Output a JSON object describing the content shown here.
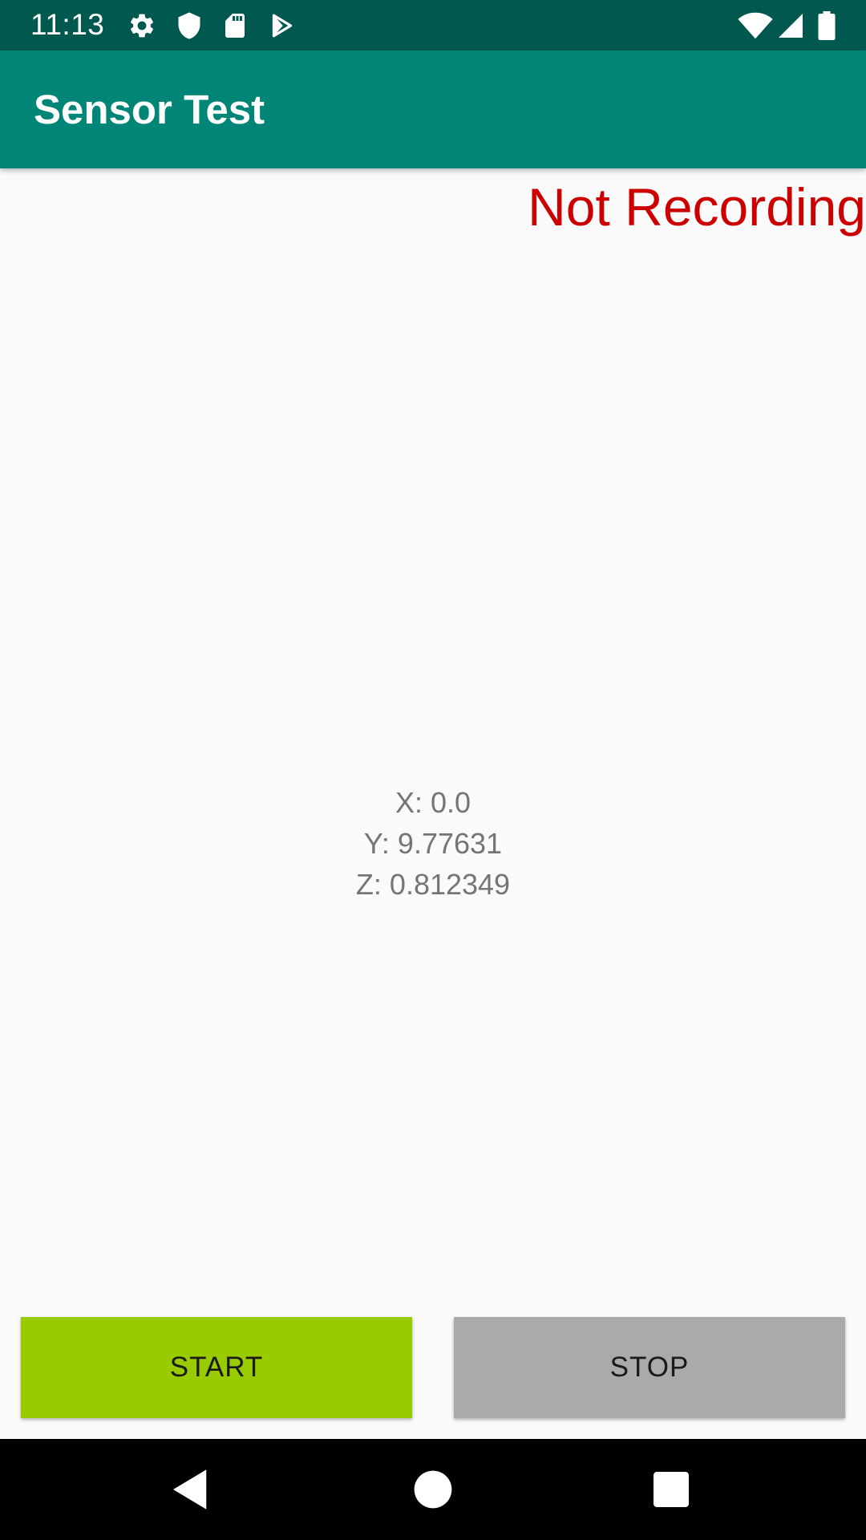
{
  "status_bar": {
    "time": "11:13",
    "icons": [
      "settings-icon",
      "shield-icon",
      "sd-card-icon",
      "play-protect-icon",
      "wifi-icon",
      "signal-icon",
      "battery-icon"
    ]
  },
  "app_bar": {
    "title": "Sensor Test"
  },
  "main": {
    "recording_status": "Not Recording",
    "readings": {
      "x": "X: 0.0",
      "y": "Y: 9.77631",
      "z": "Z: 0.812349"
    }
  },
  "buttons": {
    "start_label": "START",
    "stop_label": "STOP"
  },
  "nav_bar": {
    "buttons": [
      "back-icon",
      "home-icon",
      "recents-icon"
    ]
  },
  "colors": {
    "status_bar": "#00584f",
    "app_bar": "#008577",
    "recording_status": "#cc0000",
    "start_button": "#99cc00",
    "stop_button": "#aaaaaa"
  }
}
